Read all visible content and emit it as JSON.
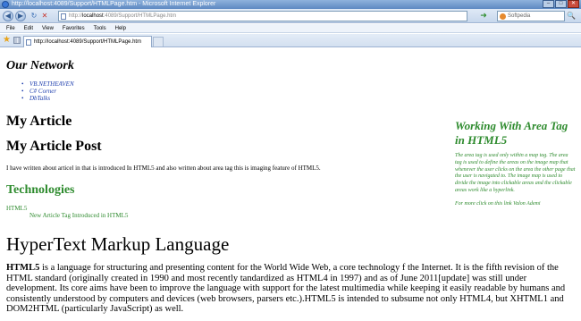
{
  "window": {
    "title": "http://localhost:4089/Support/HTMLPage.htm - Microsoft Internet Explorer",
    "buttons": {
      "minimize": "–",
      "maximize": "□",
      "close": "✕"
    }
  },
  "toolbar": {
    "back_glyph": "◀",
    "forward_glyph": "▶",
    "stop_glyph": "✕",
    "refresh_glyph": "↻",
    "address_prefix": "http://",
    "address_host": "localhost",
    "address_rest": ":4089/Support/HTMLPage.htm",
    "go_glyph": "➜",
    "search_value": "Softpedia",
    "search_glyph": "🔍"
  },
  "menu": {
    "items": [
      "File",
      "Edit",
      "View",
      "Favorites",
      "Tools",
      "Help"
    ]
  },
  "tabs": {
    "active_label": "http://localhost:4089/Support/HTMLPage.htm",
    "favorites_glyph": "★"
  },
  "page": {
    "network_heading": "Our Network",
    "network_links": [
      "VB.NETHEAVEN",
      "C# Corner",
      "DbTalks"
    ],
    "article_heading": "My Article",
    "post_heading": "My Article Post",
    "intro_text": "I have written about articel in that is introduced In HTML5 and also written about area tag this is imaging feature of HTML5.",
    "tech_heading": "Technologies",
    "tech_line1": "HTML5",
    "tech_line2": "New Article Tag Introduced in HTML5",
    "aside_title": "Working With Area Tag in HTML5",
    "aside_body": "The area tag is used only within a map tag. The area tag is used to define the areas on the image map that whenever the user clicks on the area the other page that the user is navigated to. The image map is used to divide the image into clickable areas and the clickable areas work like a hyperlink.",
    "aside_more": "For more click on this link Valon Ademi",
    "hypertext_heading": "HyperText Markup Language",
    "hyper_bold": "HTML5",
    "hyper_text": " is a language for structuring and presenting content for the World Wide Web, a core technology f the Internet. It is the fifth revision of the HTML standard (originally created in 1990 and most recently tandardized as HTML4 in 1997) and as of June 2011[update] was still under development. Its core aims have been to improve the language with support for the latest multimedia while keeping it easily readable by humans and consistently understood by computers and devices (web browsers, parsers etc.).HTML5 is intended to subsume not only HTML4, but XHTML1 and DOM2HTML (particularly JavaScript) as well."
  }
}
